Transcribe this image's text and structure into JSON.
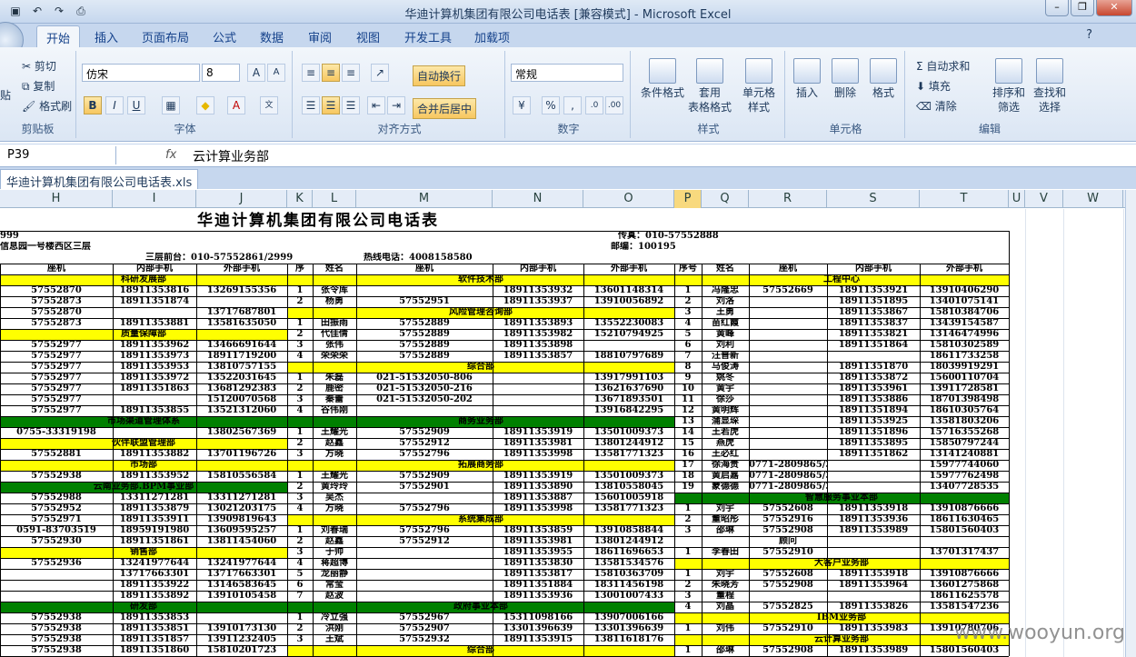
{
  "window": {
    "title": "华迪计算机集团有限公司电话表  [兼容模式] - Microsoft Excel",
    "qat_icons": [
      "save-icon",
      "undo-icon",
      "redo-icon",
      "print-preview-icon"
    ]
  },
  "tabs": [
    "开始",
    "插入",
    "页面布局",
    "公式",
    "数据",
    "审阅",
    "视图",
    "开发工具",
    "加载项"
  ],
  "ribbon": {
    "clipboard": {
      "label": "剪贴板",
      "cut": "剪切",
      "copy": "复制",
      "format_painter": "格式刷",
      "paste": "贴"
    },
    "font": {
      "label": "字体",
      "name": "仿宋",
      "size": "8",
      "bold": "B",
      "italic": "I",
      "underline": "U"
    },
    "align": {
      "label": "对齐方式",
      "wrap": "自动换行",
      "merge": "合并后居中"
    },
    "number": {
      "label": "数字",
      "format": "常规",
      "percent": "%",
      "comma": ","
    },
    "styles": {
      "label": "样式",
      "cond": "条件格式",
      "table": "套用",
      "table2": "表格格式",
      "cell": "单元格",
      "cell2": "样式"
    },
    "cells": {
      "label": "单元格",
      "insert": "插入",
      "delete": "删除",
      "format": "格式"
    },
    "edit": {
      "label": "编辑",
      "autosum": "自动求和",
      "fill": "填充",
      "clear": "清除",
      "sort": "排序和",
      "sort2": "筛选",
      "find": "查找和",
      "find2": "选择"
    }
  },
  "formula_bar": {
    "name_box": "P39",
    "fx": "fx",
    "value": "云计算业务部"
  },
  "doc_tab": "华迪计算机集团有限公司电话表.xls",
  "columns": [
    "H",
    "I",
    "J",
    "K",
    "L",
    "M",
    "N",
    "O",
    "P",
    "Q",
    "R",
    "S",
    "T",
    "U",
    "V",
    "W"
  ],
  "selected_column": "P",
  "sheet": {
    "title": "华迪计算机集团有限公司电话表",
    "fax": "传真：010-57552888",
    "fax_left": "999",
    "postcode": "邮编：100195",
    "address": "信息园一号楼西区三层",
    "front_desk": "三层前台：010-57552861/2999",
    "hotline": "热线电话：4008158580",
    "head_left": [
      "座机",
      "内部手机",
      "外部手机"
    ],
    "head_mid": [
      "序",
      "姓名",
      "座机",
      "内部手机",
      "外部手机"
    ],
    "head_right": [
      "序号",
      "姓名",
      "座机",
      "内部手机",
      "外部手机"
    ]
  },
  "rows": [
    [
      "科研发展部",
      "",
      "",
      "",
      "",
      "软件技术部",
      "",
      "",
      "",
      "",
      "工程中心",
      "",
      ""
    ],
    [
      "57552870",
      "18911353816",
      "13269155356",
      "1",
      "张令库",
      "",
      "18911353932",
      "13601148314",
      "1",
      "冯隆忠",
      "57552669",
      "18911353921",
      "13910406290"
    ],
    [
      "57552873",
      "18911351874",
      "",
      "2",
      "杨勇",
      "57552951",
      "18911353937",
      "13910056892",
      "2",
      "刘洛",
      "",
      "18911351895",
      "13401075141"
    ],
    [
      "57552870",
      "",
      "13717687801",
      "",
      "",
      "风险管理咨询部",
      "",
      "",
      "3",
      "王勇",
      "",
      "18911353867",
      "15810384706"
    ],
    [
      "57552873",
      "18911353881",
      "13581635050",
      "1",
      "田振雨",
      "57552889",
      "18911353893",
      "13552230083",
      "4",
      "苗红霞",
      "",
      "18911353837",
      "13439154587"
    ],
    [
      "质量保障部",
      "",
      "",
      "2",
      "代佳倩",
      "57552889",
      "18911353982",
      "15210794925",
      "5",
      "黄峰",
      "",
      "18911353821",
      "13146474996"
    ],
    [
      "57552977",
      "18911353962",
      "13466691644",
      "3",
      "张伟",
      "57552889",
      "18911353898",
      "",
      "6",
      "刘利",
      "",
      "18911351864",
      "15810302589"
    ],
    [
      "57552977",
      "18911353973",
      "18911719200",
      "4",
      "荣荣荣",
      "57552889",
      "18911353857",
      "18810797689",
      "7",
      "汪普新",
      "",
      "",
      "18611733258"
    ],
    [
      "57552977",
      "18911353953",
      "13810757155",
      "",
      "",
      "综合部",
      "",
      "",
      "8",
      "马俊涛",
      "",
      "18911351870",
      "18039919291"
    ],
    [
      "57552977",
      "18911353972",
      "13522031645",
      "1",
      "朱磊",
      "021-51532050-806",
      "",
      "13917991103",
      "9",
      "姚冬",
      "",
      "18911353872",
      "15600110704"
    ],
    [
      "57552977",
      "18911351863",
      "13681292383",
      "2",
      "鹿密",
      "021-51532050-216",
      "",
      "13621637690",
      "10",
      "黄宇",
      "",
      "18911353961",
      "13911728581"
    ],
    [
      "57552977",
      "",
      "15120070568",
      "3",
      "秦蕾",
      "021-51532050-202",
      "",
      "13671893501",
      "11",
      "徐莎",
      "",
      "18911353886",
      "18701398498"
    ],
    [
      "57552977",
      "18911353855",
      "13521312060",
      "4",
      "谷伟刚",
      "",
      "",
      "13916842295",
      "12",
      "黄明辉",
      "",
      "18911351894",
      "18610305764"
    ],
    [
      "市场渠道管理体系",
      "",
      "",
      "",
      "",
      "商务业务部",
      "",
      "",
      "13",
      "蒲显琛",
      "",
      "18911353925",
      "13581803206"
    ],
    [
      "0755-33319198",
      "",
      "13802567369",
      "1",
      "王耀光",
      "57552909",
      "18911353919",
      "13501009373",
      "14",
      "王若虎",
      "",
      "18911351896",
      "15716355268"
    ],
    [
      "伙伴联盟管理部",
      "",
      "",
      "2",
      "赵鑫",
      "57552912",
      "18911353981",
      "13801244912",
      "15",
      "燕虎",
      "",
      "18911353895",
      "15850797244"
    ],
    [
      "57552881",
      "18911353882",
      "13701196726",
      "3",
      "方晓",
      "57552796",
      "18911353998",
      "13581771323",
      "16",
      "王必红",
      "",
      "18911351862",
      "13141240881"
    ],
    [
      "市场部",
      "",
      "",
      "",
      "",
      "拓展商务部",
      "",
      "",
      "17",
      "徐海贵",
      "0771-2809865/3189374",
      "",
      "15977744060"
    ],
    [
      "57552938",
      "18911353952",
      "15810556584",
      "1",
      "王耀光",
      "57552909",
      "18911353919",
      "13501009373",
      "18",
      "黄启嘉",
      "0771-2809865/3189375",
      "",
      "15977762498"
    ],
    [
      "云南业务部.BPM事业部",
      "",
      "",
      "2",
      "黄玲玲",
      "57552901",
      "18911353890",
      "13810558045",
      "19",
      "蒙德德",
      "0771-2809865/3189376",
      "",
      "13407728535"
    ],
    [
      "57552988",
      "13311271281",
      "13311271281",
      "3",
      "吴杰",
      "",
      "18911353887",
      "15601005918",
      "",
      "",
      "智慧服务事业本部",
      "",
      ""
    ],
    [
      "57552952",
      "18911353879",
      "13021203175",
      "4",
      "方晓",
      "57552796",
      "18911353998",
      "13581771323",
      "1",
      "刘宇",
      "57552608",
      "18911353918",
      "13910876666"
    ],
    [
      "57552971",
      "18911353911",
      "13909819643",
      "",
      "",
      "系统集成部",
      "",
      "",
      "2",
      "董昭彤",
      "57552916",
      "18911353936",
      "18611630465"
    ],
    [
      "0591-83703519",
      "18959191980",
      "13609595257",
      "1",
      "刘春瑞",
      "57552796",
      "18911353859",
      "13910858844",
      "3",
      "邵琳",
      "57552908",
      "18911353989",
      "15801560403"
    ],
    [
      "57552930",
      "18911351861",
      "13811454060",
      "2",
      "赵鑫",
      "57552912",
      "18911353981",
      "13801244912",
      "",
      "",
      "顾问",
      "",
      ""
    ],
    [
      "销售部",
      "",
      "",
      "3",
      "于帅",
      "",
      "18911353955",
      "18611696653",
      "1",
      "李春田",
      "57552910",
      "",
      "13701317437"
    ],
    [
      "57552936",
      "13241977644",
      "13241977644",
      "4",
      "蒋超博",
      "",
      "18911353830",
      "13581534576",
      "",
      "",
      "大客户业务部",
      "",
      ""
    ],
    [
      "",
      "13717663301",
      "13717663301",
      "5",
      "龙丽静",
      "",
      "18911353817",
      "15810363709",
      "1",
      "刘宇",
      "57552608",
      "18911353918",
      "13910876666"
    ],
    [
      "",
      "18911353922",
      "13146583645",
      "6",
      "常莹",
      "",
      "18911351884",
      "18311456198",
      "2",
      "朱晓芳",
      "57552908",
      "18911353964",
      "13601275868"
    ],
    [
      "",
      "18911353892",
      "13910105458",
      "7",
      "赵波",
      "",
      "18911353936",
      "13001007433",
      "3",
      "董程",
      "",
      "",
      "18611625578"
    ],
    [
      "研发部",
      "",
      "",
      "",
      "",
      "政府事业本部",
      "",
      "",
      "4",
      "刘晶",
      "57552825",
      "18911353826",
      "13581547236"
    ],
    [
      "57552938",
      "18911353853",
      "",
      "1",
      "冷立强",
      "57552967",
      "15311098166",
      "13907006166",
      "",
      "",
      "IBM业务部",
      "",
      ""
    ],
    [
      "57552938",
      "18911353851",
      "13910173130",
      "2",
      "洪刚",
      "57552907",
      "13301396639",
      "13301396639",
      "1",
      "刘伟",
      "57552910",
      "18911353983",
      "13910780706"
    ],
    [
      "57552938",
      "18911351857",
      "13911232405",
      "3",
      "王斌",
      "57552932",
      "18911353915",
      "13811618176",
      "",
      "",
      "云计算业务部",
      "",
      ""
    ],
    [
      "57552938",
      "18911351860",
      "15810201723",
      "",
      "",
      "综合部",
      "",
      "",
      "1",
      "邵琳",
      "57552908",
      "18911353989",
      "15801560403"
    ]
  ],
  "watermark": "www.wooyun.org"
}
